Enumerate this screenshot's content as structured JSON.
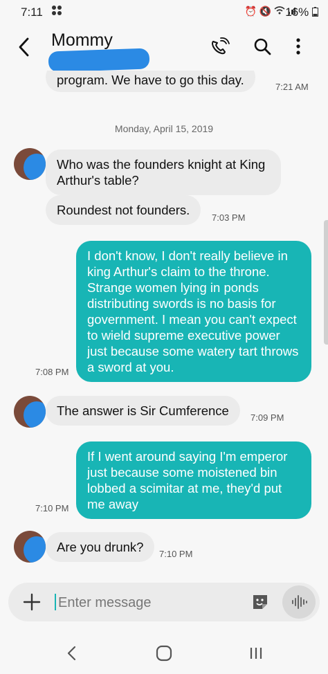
{
  "status_bar": {
    "time": "7:11",
    "left_icon": "game-controller-icon",
    "right_icons": [
      "alarm-icon",
      "mute-icon",
      "wifi-icon",
      "signal-icon"
    ],
    "battery": "16%"
  },
  "header": {
    "contact_name": "Mommy",
    "back_icon": "back-arrow-icon",
    "call_icon": "wifi-call-icon",
    "search_icon": "search-icon",
    "more_icon": "more-vert-icon"
  },
  "thread": {
    "partial_message": {
      "text": "program.  We have to go this day.",
      "time": "7:21 AM"
    },
    "date_separator": "Monday, April 15, 2019",
    "messages": [
      {
        "dir": "in",
        "text": "Who was the founders knight at King Arthur's table?",
        "time": ""
      },
      {
        "dir": "in",
        "text": "Roundest not founders.",
        "time": "7:03 PM"
      },
      {
        "dir": "out",
        "text": "I don't know, I don't really believe in king Arthur's claim to the throne. Strange women lying in ponds distributing swords is no basis for government. I mean you can't expect to wield supreme executive power just because some watery tart throws a sword at you.",
        "time": "7:08 PM"
      },
      {
        "dir": "in",
        "text": "The answer is Sir Cumference",
        "time": "7:09 PM"
      },
      {
        "dir": "out",
        "text": "If I went around saying I'm emperor just because some moistened bin lobbed a scimitar at me, they'd put me away",
        "time": "7:10 PM"
      },
      {
        "dir": "in",
        "text": "Are you drunk?",
        "time": "7:10 PM"
      }
    ]
  },
  "composer": {
    "placeholder": "Enter message",
    "plus_icon": "plus-icon",
    "sticker_icon": "sticker-icon",
    "voice_icon": "voice-wave-icon"
  },
  "nav": {
    "back_icon": "nav-back-icon",
    "home_icon": "nav-home-icon",
    "recents_icon": "nav-recents-icon"
  },
  "colors": {
    "outgoing_bubble": "#18b5b5",
    "incoming_bubble": "#ebebeb",
    "redaction": "#2b8ae4",
    "background": "#f7f7f7"
  }
}
